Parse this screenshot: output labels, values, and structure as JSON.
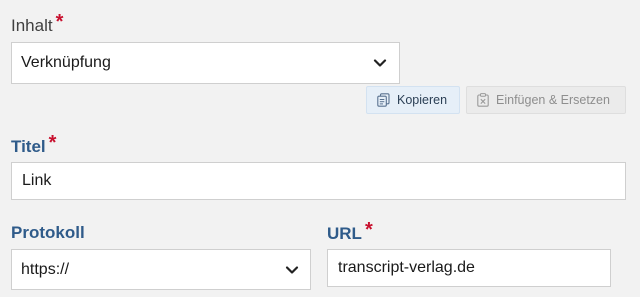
{
  "content_field": {
    "label": "Inhalt",
    "required_marker": "*",
    "selected_value": "Verknüpfung"
  },
  "actions": {
    "copy_label": "Kopieren",
    "paste_replace_label": "Einfügen & Ersetzen"
  },
  "title_field": {
    "label": "Titel",
    "required_marker": "*",
    "value": "Link"
  },
  "protocol_field": {
    "label": "Protokoll",
    "selected_value": "https://"
  },
  "url_field": {
    "label": "URL",
    "required_marker": "*",
    "value": "transcript-verlag.de"
  },
  "icons": {
    "dropdown": "chevron-down-icon",
    "copy": "copy-icon",
    "paste": "clipboard-paste-icon"
  },
  "colors": {
    "required": "#c8102e",
    "label_blue": "#2f5b8a",
    "copy_button_bg": "#e6eff8"
  }
}
